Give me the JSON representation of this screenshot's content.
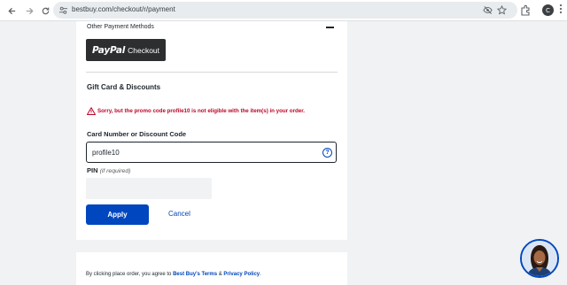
{
  "browser": {
    "url": "bestbuy.com/checkout/r/payment",
    "profile_initial": "C"
  },
  "payment": {
    "other_methods_label": "Other Payment Methods",
    "paypal_logo": "PayPal",
    "paypal_label": "Checkout"
  },
  "gift_card": {
    "title": "Gift Card & Discounts",
    "error_message": "Sorry, but the promo code profile10 is not eligible with the item(s) in your order.",
    "code_label": "Card Number or Discount Code",
    "code_value": "profile10",
    "help_glyph": "?",
    "pin_label": "PIN",
    "pin_hint": "(if required)",
    "pin_value": "",
    "apply_label": "Apply",
    "cancel_label": "Cancel"
  },
  "footer": {
    "terms_prefix": "By clicking place order, you agree to ",
    "terms_link": "Best Buy's Terms",
    "terms_and": " & ",
    "privacy_link": "Privacy Policy",
    "terms_suffix": "."
  },
  "colors": {
    "brand_blue": "#0046be",
    "error_red": "#bb0628",
    "paypal_dark": "#2c2e2f"
  },
  "icons": [
    "back-icon",
    "forward-icon",
    "reload-icon",
    "site-settings-icon",
    "eye-off-icon",
    "star-icon",
    "extensions-icon",
    "menu-icon",
    "warning-icon",
    "help-icon",
    "minus-icon"
  ]
}
